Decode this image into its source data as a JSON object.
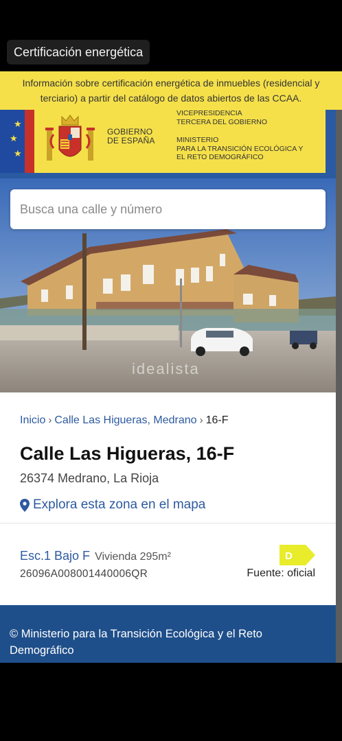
{
  "app": {
    "title": "Certificación energética"
  },
  "notice": {
    "line1": "Información sobre certificación energética de inmuebles (residencial y",
    "line2": "terciario) a partir del catálogo de datos abiertos de las CCAA."
  },
  "gov": {
    "name_line1": "GOBIERNO",
    "name_line2": "DE ESPAÑA",
    "vice_line1": "VICEPRESIDENCIA",
    "vice_line2": "TERCERA DEL GOBIERNO",
    "min_line1": "MINISTERIO",
    "min_line2": "PARA LA TRANSICIÓN ECOLÓGICA Y",
    "min_line3": "EL RETO DEMOGRÁFICO"
  },
  "search": {
    "placeholder": "Busca una calle y número"
  },
  "photo": {
    "watermark": "idealista"
  },
  "breadcrumb": {
    "home": "Inicio",
    "street": "Calle Las Higueras, Medrano",
    "current": "16-F"
  },
  "property": {
    "title": "Calle Las Higueras, 16-F",
    "address": "26374 Medrano, La Rioja",
    "map_link": "Explora esta zona en el mapa"
  },
  "unit": {
    "name": "Esc.1 Bajo F",
    "meta": "Vivienda 295m²",
    "reference": "26096A008001440006QR",
    "rating": "D",
    "source": "Fuente: oficial"
  },
  "colors": {
    "accent": "#2d5aa0",
    "notice_bg": "#f5e04a",
    "footer_bg": "#1f4f8a",
    "rating_d": "#e8ec2a"
  },
  "footer": {
    "text": "© Ministerio para la Transición Ecológica y el Reto Demográfico"
  }
}
